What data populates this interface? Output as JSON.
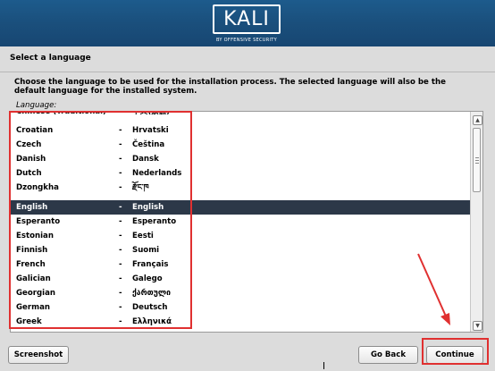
{
  "header": {
    "logo_text": "KALI",
    "logo_subtitle": "BY OFFENSIVE SECURITY"
  },
  "page": {
    "title": "Select a language",
    "description": "Choose the language to be used for the installation process. The selected language will also be the default language for the installed system.",
    "list_label": "Language:"
  },
  "languages": [
    {
      "name": "Chinese (Traditional)",
      "native": "中文(繁體)"
    },
    {
      "name": "Croatian",
      "native": "Hrvatski"
    },
    {
      "name": "Czech",
      "native": "Čeština"
    },
    {
      "name": "Danish",
      "native": "Dansk"
    },
    {
      "name": "Dutch",
      "native": "Nederlands"
    },
    {
      "name": "Dzongkha",
      "native": "རྫོང་ཁ"
    },
    {
      "name": "English",
      "native": "English",
      "selected": true
    },
    {
      "name": "Esperanto",
      "native": "Esperanto"
    },
    {
      "name": "Estonian",
      "native": "Eesti"
    },
    {
      "name": "Finnish",
      "native": "Suomi"
    },
    {
      "name": "French",
      "native": "Français"
    },
    {
      "name": "Galician",
      "native": "Galego"
    },
    {
      "name": "Georgian",
      "native": "ქართული"
    },
    {
      "name": "German",
      "native": "Deutsch"
    },
    {
      "name": "Greek",
      "native": "Ελληνικά"
    }
  ],
  "separator": "-",
  "buttons": {
    "screenshot": "Screenshot",
    "go_back": "Go Back",
    "continue": "Continue"
  },
  "colors": {
    "banner": "#1a4f7c",
    "selection": "#2c3848",
    "annotation": "#e03030"
  }
}
